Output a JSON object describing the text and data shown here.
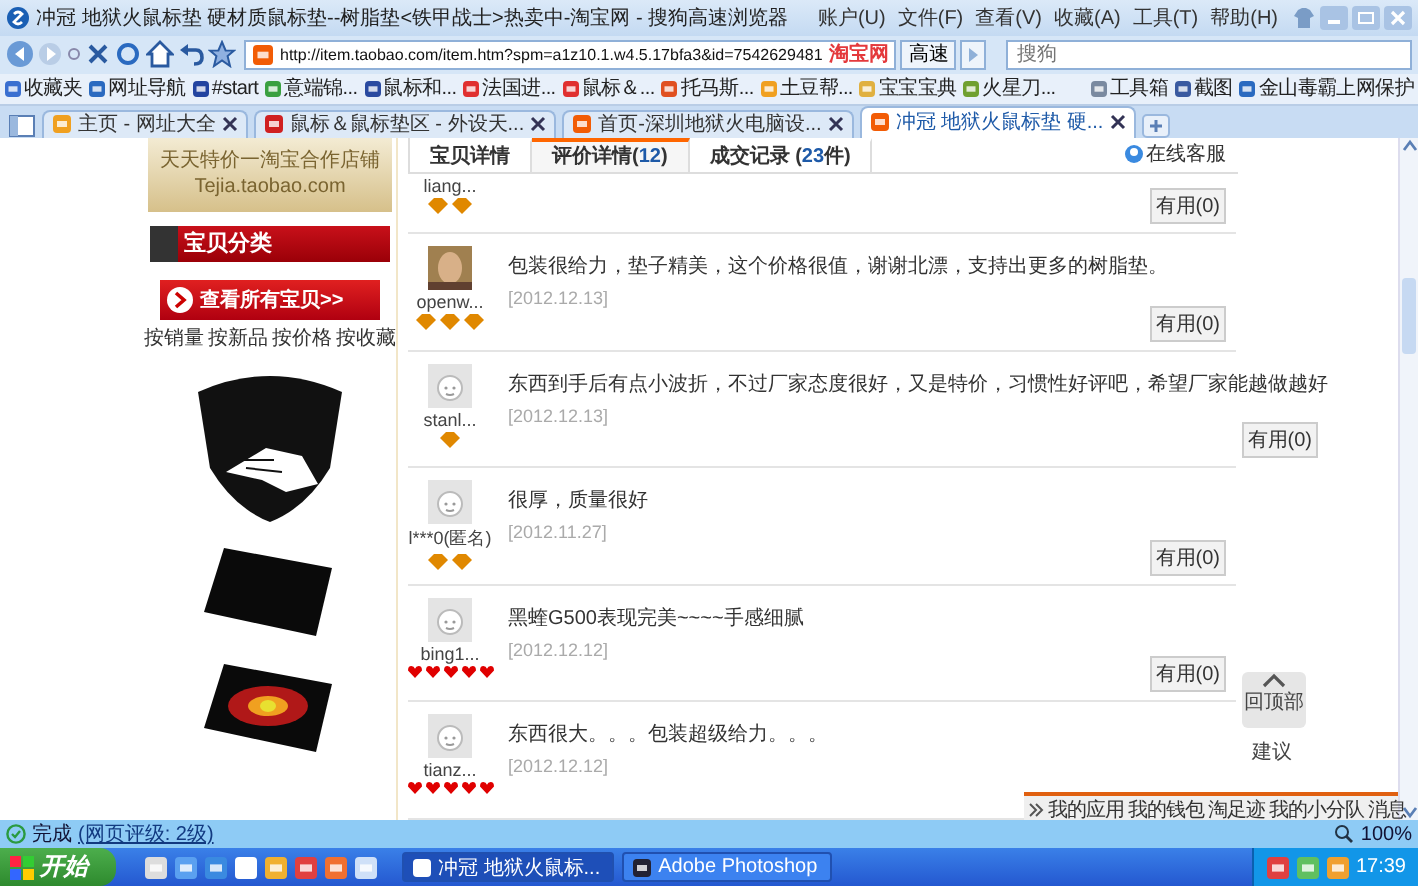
{
  "window": {
    "title": "冲冠 地狱火鼠标垫 硬材质鼠标垫--树脂垫<铁甲战士>热卖中-淘宝网 - 搜狗高速浏览器",
    "menu": [
      "账户(U)",
      "文件(F)",
      "查看(V)",
      "收藏(A)",
      "工具(T)",
      "帮助(H)"
    ]
  },
  "address_bar": {
    "url": "http://item.taobao.com/item.htm?spm=a1z10.1.w4.5.17bfa3&id=7542629481",
    "site_badge": "淘宝网",
    "speed_button": "高速",
    "search_placeholder": "搜狗"
  },
  "bookmarks": {
    "items": [
      "收藏夹",
      "网址导航",
      "#start",
      "意端锦...",
      "鼠标和...",
      "法国进...",
      "鼠标＆...",
      "托马斯...",
      "土豆帮...",
      "宝宝宝典",
      "火星刀..."
    ],
    "right_items": [
      "工具箱",
      "截图",
      "金山毒霸上网保护"
    ]
  },
  "tabs": [
    {
      "label": "主页 - 网址大全",
      "selected": false
    },
    {
      "label": "鼠标＆鼠标垫区 - 外设天...",
      "selected": false
    },
    {
      "label": "首页-深圳地狱火电脑设...",
      "selected": false
    },
    {
      "label": "冲冠 地狱火鼠标垫 硬...",
      "selected": true
    }
  ],
  "shop_sidebar": {
    "banner_title": "天天特价一淘宝合作店铺",
    "banner_url": "Tejia.taobao.com",
    "category_heading": "宝贝分类",
    "view_all": "查看所有宝贝>>",
    "sort_links": [
      "按销量",
      "按新品",
      "按价格",
      "按收藏"
    ]
  },
  "review_tabs": [
    {
      "label": "宝贝详情",
      "selected": false
    },
    {
      "label": "评价详情(",
      "count": "12",
      "suffix": ")",
      "selected": true
    },
    {
      "label": "成交记录 (",
      "count": "23",
      "suffix": "件)",
      "selected": false
    }
  ],
  "online_service": "在线客服",
  "reviews": [
    {
      "user": "liang...",
      "rank": [
        {
          "kind": "diamond"
        },
        {
          "kind": "diamond"
        }
      ],
      "useful": "有用(0)"
    },
    {
      "user": "openw...",
      "photo": true,
      "rank": [
        {
          "kind": "diamond"
        },
        {
          "kind": "diamond"
        },
        {
          "kind": "diamond"
        }
      ],
      "text": "包装很给力，垫子精美，这个价格很值，谢谢北漂，支持出更多的树脂垫。",
      "date": "[2012.12.13]",
      "useful": "有用(0)"
    },
    {
      "user": "stanl...",
      "photo": false,
      "rank": [
        {
          "kind": "diamond"
        }
      ],
      "text": "东西到手后有点小波折，不过厂家态度很好，又是特价，习惯性好评吧，希望厂家能越做越好",
      "date": "[2012.12.13]",
      "useful": "有用(0)"
    },
    {
      "user": "l***0(匿名)",
      "photo": false,
      "rank": [
        {
          "kind": "diamond"
        },
        {
          "kind": "diamond"
        }
      ],
      "text": "很厚，质量很好",
      "date": "[2012.11.27]",
      "useful": "有用(0)"
    },
    {
      "user": "bing1...",
      "photo": false,
      "rank": [
        {
          "kind": "heart"
        },
        {
          "kind": "heart"
        },
        {
          "kind": "heart"
        },
        {
          "kind": "heart"
        },
        {
          "kind": "heart"
        }
      ],
      "text": "黑蝰G500表现完美~~~~手感细腻",
      "date": "[2012.12.12]",
      "useful": "有用(0)"
    },
    {
      "user": "tianz...",
      "photo": false,
      "rank": [
        {
          "kind": "heart"
        },
        {
          "kind": "heart"
        },
        {
          "kind": "heart"
        },
        {
          "kind": "heart"
        },
        {
          "kind": "heart"
        }
      ],
      "text": "东西很大。。。包装超级给力。。。",
      "date": "[2012.12.12]"
    }
  ],
  "back_to_top": "回顶部",
  "feedback": "建议",
  "mini_bar": [
    "我的应用",
    "我的钱包",
    "淘足迹",
    "我的小分队",
    "消息"
  ],
  "status_bar": {
    "text": "完成",
    "rating": "(网页评级: 2级)",
    "zoom": "100%"
  },
  "taskbar": {
    "start": "开始",
    "tasks": [
      {
        "label": "冲冠 地狱火鼠标...",
        "selected": true
      },
      {
        "label": "Adobe Photoshop",
        "selected": false
      }
    ],
    "clock": "17:39"
  }
}
